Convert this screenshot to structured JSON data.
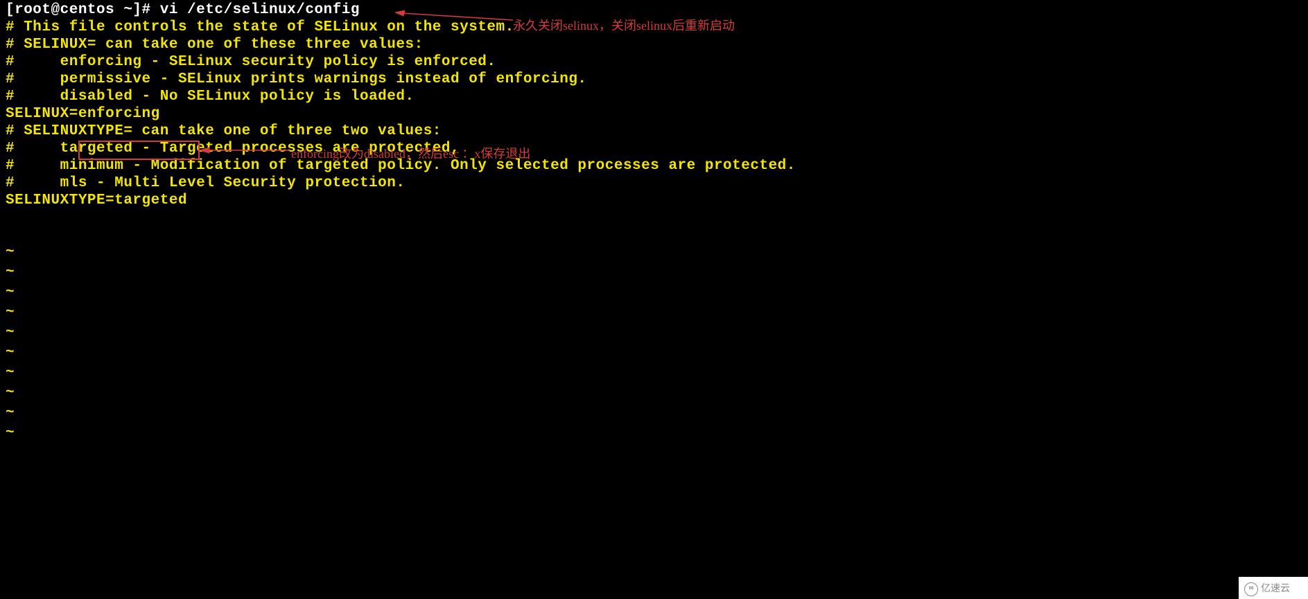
{
  "terminal": {
    "prompt_host": "[root@centos ~]# ",
    "command": "vi /etc/selinux/config",
    "blank": "",
    "file_content": [
      "# This file controls the state of SELinux on the system.",
      "# SELINUX= can take one of these three values:",
      "#     enforcing - SELinux security policy is enforced.",
      "#     permissive - SELinux prints warnings instead of enforcing.",
      "#     disabled - No SELinux policy is loaded.",
      "SELINUX=enforcing",
      "# SELINUXTYPE= can take one of three two values:",
      "#     targeted - Targeted processes are protected,",
      "#     minimum - Modification of targeted policy. Only selected processes are protected.",
      "#     mls - Multi Level Security protection.",
      "SELINUXTYPE=targeted"
    ],
    "tilde": "~",
    "tilde_count": 10
  },
  "annotations": {
    "note_top": "永久关闭selinux，关闭selinux后重新启动",
    "note_middle": "enforcing改为disabled，然后esc ：x保存退出"
  },
  "watermark": {
    "icon_label": "∞",
    "text": "亿速云"
  }
}
